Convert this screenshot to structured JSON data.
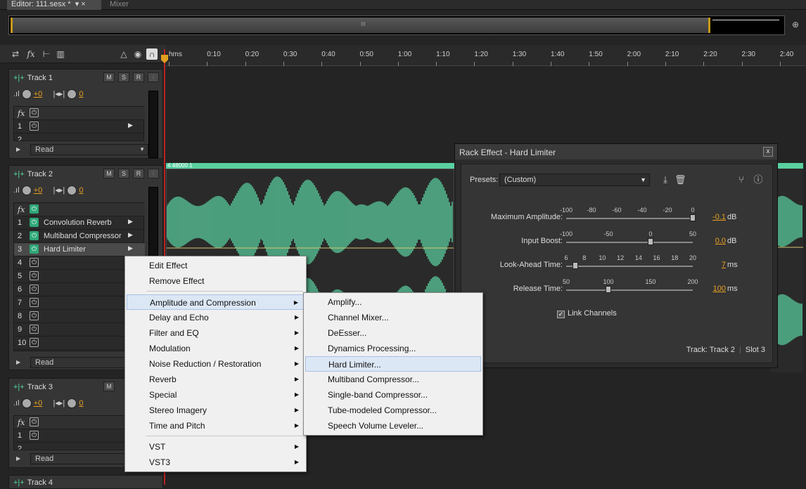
{
  "tabs": {
    "editor": "Editor: 111.sesx *",
    "mixer": "Mixer"
  },
  "overview": {
    "mid_glyph": "III"
  },
  "toolbar": {
    "icons": [
      "swap-icon",
      "fx-icon",
      "send-icon",
      "eq-icon"
    ]
  },
  "ruler": {
    "ticks": [
      "hms",
      "0:10",
      "0:20",
      "0:30",
      "0:40",
      "0:50",
      "1:00",
      "1:10",
      "1:20",
      "1:30",
      "1:40",
      "1:50",
      "2:00",
      "2:10",
      "2:20",
      "2:30",
      "2:40"
    ]
  },
  "colors": {
    "waveform": "#5ad0a0",
    "accent": "#e8a020",
    "playhead": "#b22222"
  },
  "tracks": [
    {
      "name": "Track 1",
      "volume": "+0",
      "pan": "0",
      "mode": "Read",
      "slots": [
        "1",
        "2"
      ]
    },
    {
      "name": "Track 2",
      "volume": "+0",
      "pan": "0",
      "mode": "Read",
      "clip_label": "4 48000 1",
      "effects": [
        {
          "n": "1",
          "name": "Convolution Reverb"
        },
        {
          "n": "2",
          "name": "Multiband Compressor"
        },
        {
          "n": "3",
          "name": "Hard Limiter"
        },
        {
          "n": "4",
          "name": ""
        },
        {
          "n": "5",
          "name": ""
        },
        {
          "n": "6",
          "name": ""
        },
        {
          "n": "7",
          "name": ""
        },
        {
          "n": "8",
          "name": ""
        },
        {
          "n": "9",
          "name": ""
        },
        {
          "n": "10",
          "name": ""
        }
      ]
    },
    {
      "name": "Track 3",
      "volume": "+0",
      "pan": "0",
      "mode": "Read",
      "slots": [
        "1",
        "2"
      ]
    },
    {
      "name": "Track 4"
    }
  ],
  "buttons": {
    "m": "M",
    "s": "S",
    "r": "R",
    "i": "I"
  },
  "rack": {
    "title": "Rack Effect - Hard Limiter",
    "close": "x",
    "presets_label": "Presets:",
    "preset_value": "(Custom)",
    "params": [
      {
        "label": "Maximum Amplitude:",
        "scale": [
          "-100",
          "-80",
          "-60",
          "-40",
          "-20",
          "0"
        ],
        "value": "-0.1",
        "unit": "dB",
        "fraction": 0.999
      },
      {
        "label": "Input Boost:",
        "scale": [
          "-100",
          "-50",
          "0",
          "50"
        ],
        "value": "0.0",
        "unit": "dB",
        "fraction": 0.667
      },
      {
        "label": "Look-Ahead Time:",
        "scale": [
          "6",
          "8",
          "10",
          "12",
          "14",
          "16",
          "18",
          "20"
        ],
        "value": "7",
        "unit": "ms",
        "fraction": 0.071
      },
      {
        "label": "Release Time:",
        "scale": [
          "50",
          "100",
          "150",
          "200"
        ],
        "value": "100",
        "unit": "ms",
        "fraction": 0.333
      }
    ],
    "link_channels": "Link Channels",
    "footer_track": "Track: Track 2",
    "footer_slot": "Slot 3"
  },
  "context_menu": {
    "items": [
      "Edit Effect",
      "Remove Effect",
      "Amplitude and Compression",
      "Delay and Echo",
      "Filter and EQ",
      "Modulation",
      "Noise Reduction / Restoration",
      "Reverb",
      "Special",
      "Stereo Imagery",
      "Time and Pitch",
      "VST",
      "VST3"
    ]
  },
  "submenu": {
    "items": [
      "Amplify...",
      "Channel Mixer...",
      "DeEsser...",
      "Dynamics Processing...",
      "Hard Limiter...",
      "Multiband Compressor...",
      "Single-band Compressor...",
      "Tube-modeled Compressor...",
      "Speech Volume Leveler..."
    ]
  }
}
